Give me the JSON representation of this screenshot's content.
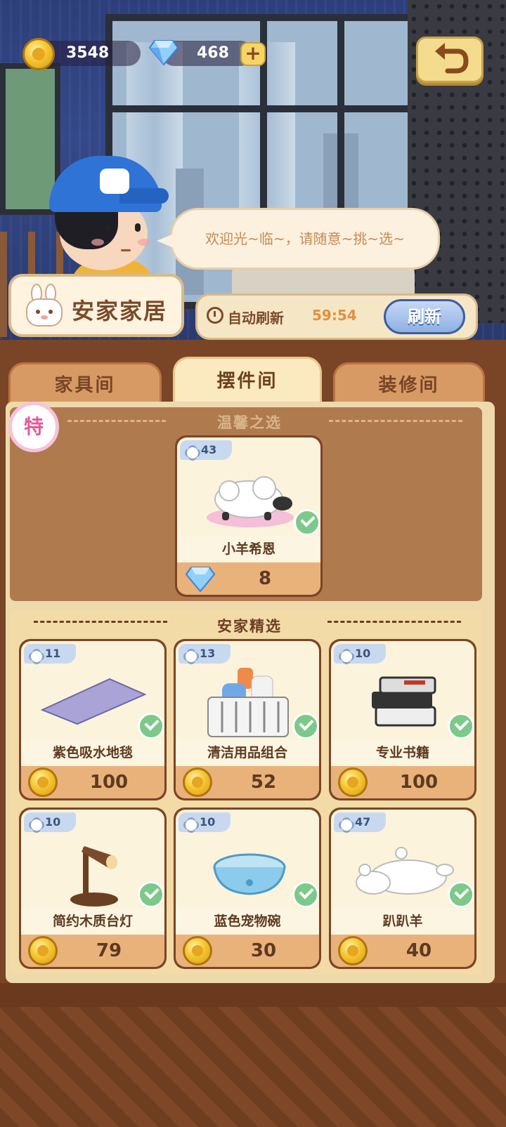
{
  "currency": {
    "coins": "3548",
    "gems": "468",
    "add_label": "+"
  },
  "npc": {
    "speech": "欢迎光~临~，请随意~挑~选~"
  },
  "shop": {
    "name": "安家家居",
    "refresh_label": "自动刷新",
    "timer": "59:54",
    "refresh_button": "刷新"
  },
  "tabs": [
    {
      "label": "家具间",
      "active": false
    },
    {
      "label": "摆件间",
      "active": true
    },
    {
      "label": "装修间",
      "active": false
    }
  ],
  "featured": {
    "badge": "特",
    "section_title": "温馨之选",
    "item": {
      "level": "43",
      "name": "小羊希恩",
      "price": "8",
      "currency": "gem",
      "owned": true
    }
  },
  "selection": {
    "section_title": "安家精选",
    "items": [
      {
        "level": "11",
        "name": "紫色吸水地毯",
        "price": "100",
        "currency": "coin",
        "owned": true
      },
      {
        "level": "13",
        "name": "清洁用品组合",
        "price": "52",
        "currency": "coin",
        "owned": true
      },
      {
        "level": "10",
        "name": "专业书籍",
        "price": "100",
        "currency": "coin",
        "owned": true
      },
      {
        "level": "10",
        "name": "简约木质台灯",
        "price": "79",
        "currency": "coin",
        "owned": true
      },
      {
        "level": "10",
        "name": "蓝色宠物碗",
        "price": "30",
        "currency": "coin",
        "owned": true
      },
      {
        "level": "47",
        "name": "趴趴羊",
        "price": "40",
        "currency": "coin",
        "owned": true
      }
    ]
  },
  "icons": {
    "coin": "coin-icon",
    "gem": "gem-icon",
    "back": "back-arrow-icon",
    "clock": "clock-refresh-icon",
    "check": "owned-check-icon",
    "flower": "level-flower-icon",
    "bunny": "bunny-logo-icon"
  },
  "colors": {
    "panel": "#7a4526",
    "tab_active": "#fbe9bf",
    "price_bar": "#e9b27a",
    "check": "#7cc98a",
    "timer": "#e48f3c"
  }
}
